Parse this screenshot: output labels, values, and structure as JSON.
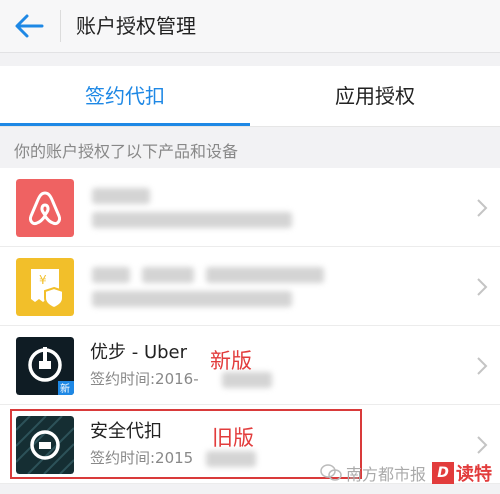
{
  "header": {
    "title": "账户授权管理"
  },
  "tabs": [
    {
      "label": "签约代扣"
    },
    {
      "label": "应用授权"
    }
  ],
  "section_label": "你的账户授权了以下产品和设备",
  "items": [
    {
      "name": "",
      "date_prefix": "",
      "icon": "airbnb-icon",
      "icon_color": "#ef6262"
    },
    {
      "name": "",
      "date_prefix": "",
      "icon": "receipt-shield-icon",
      "icon_color": "#f2bf2a"
    },
    {
      "name": "优步 - Uber",
      "date_prefix": "签约时间:2016-",
      "icon": "uber-new-icon",
      "icon_color": "#0f1c24",
      "badge": "新",
      "tag": "新版"
    },
    {
      "name": "安全代扣",
      "date_prefix": "签约时间:2015",
      "icon": "uber-old-icon",
      "icon_color": "#152e33",
      "tag": "旧版"
    }
  ],
  "watermark": {
    "text": "南方都市报",
    "logo_badge": "D",
    "logo_text": "读特"
  },
  "colors": {
    "accent": "#1e88e5",
    "annotation": "#e23c3c"
  }
}
